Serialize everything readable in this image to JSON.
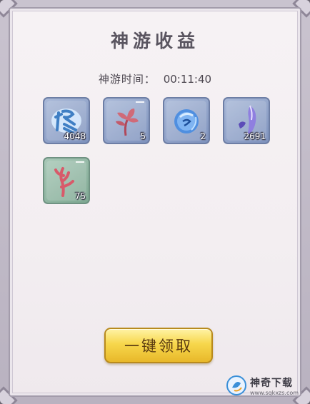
{
  "dialog": {
    "title": "神游收益",
    "travel_time_label": "神游时间：",
    "travel_time_value": "00:11:40"
  },
  "rewards": [
    {
      "icon": "cultivation-xiu-icon",
      "count": "4048",
      "frame_color": "#7e92bd"
    },
    {
      "icon": "red-herb-icon",
      "count": "5",
      "frame_color": "#7e92bd"
    },
    {
      "icon": "blue-spirit-orb-icon",
      "count": "2",
      "frame_color": "#7e92bd"
    },
    {
      "icon": "violet-crystal-icon",
      "count": "2691",
      "frame_color": "#7e92bd"
    },
    {
      "icon": "red-coral-icon",
      "count": "75",
      "frame_color": "#7ea892"
    }
  ],
  "claim_button": {
    "label": "一键领取",
    "color": "#f7d74c"
  },
  "watermark": {
    "name": "神奇下载",
    "url": "www.sqkxzs.com"
  }
}
